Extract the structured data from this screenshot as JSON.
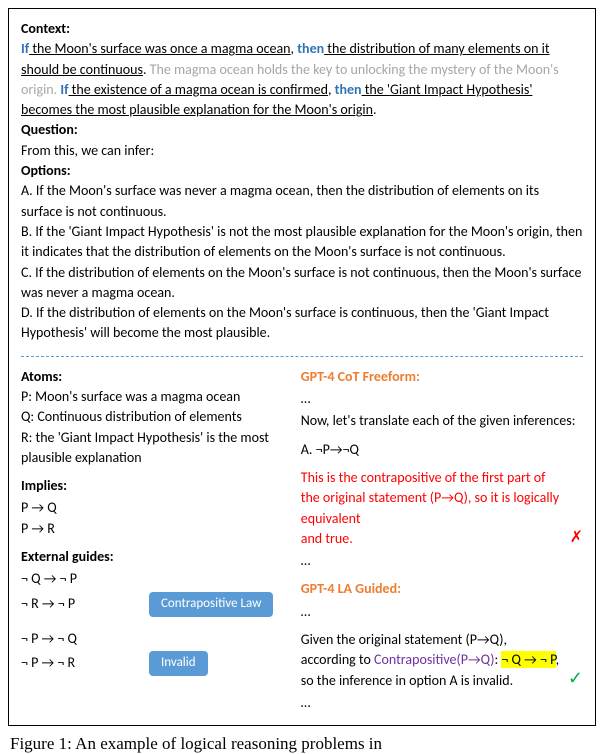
{
  "context": {
    "label": "Context:",
    "s1_if": "If",
    "s1_cond": " the Moon's surface was once a magma ocean",
    "s1_comma": ", ",
    "s1_then": "then",
    "s1_cons": " the distribution of many elements on it should be continuous",
    "s1_period": ". ",
    "s2": "The magma ocean holds the key to unlocking the mystery of the Moon's origin. ",
    "s3_if": "If",
    "s3_cond": " the existence of a magma ocean is confirmed",
    "s3_comma": ", ",
    "s3_then": "then",
    "s3_cons": " the 'Giant Impact Hypothesis' becomes the most plausible explanation for the Moon's origin",
    "s3_period": "."
  },
  "question": {
    "label": "Question:",
    "text": "From this, we can infer:"
  },
  "options": {
    "label": "Options:",
    "A": "A. If the Moon's surface was never a magma ocean, then the distribution of elements on its surface is not continuous.",
    "B": "B. If the 'Giant Impact Hypothesis' is not the most plausible explanation for the Moon's origin, then it indicates that the distribution of elements on the Moon's surface is not continuous.",
    "C": "C. If the distribution of elements on the Moon's surface is not continuous, then the Moon's surface was never a magma ocean.",
    "D": "D. If the distribution of elements on the Moon's surface is continuous, then the 'Giant Impact Hypothesis' will become the most plausible."
  },
  "left": {
    "atoms_label": "Atoms:",
    "P": "P: Moon's surface was a magma ocean",
    "Q": "Q: Continuous distribution of elements",
    "R": "R: the 'Giant Impact Hypothesis' is the most plausible explanation",
    "implies_label": "Implies:",
    "imp1": "P → Q",
    "imp2": "P → R",
    "guides_label": "External guides:",
    "g1a": "¬ Q → ¬ P",
    "g1b": "¬ R → ¬ P",
    "pill1": "Contrapositive Law",
    "g2a": "¬ P → ¬ Q",
    "g2b": "¬ P → ¬ R",
    "pill2": "Invalid"
  },
  "right": {
    "freeform_label": "GPT-4 CoT Freeform:",
    "ell": "…",
    "line1": "Now, let's translate each of the given inferences:",
    "line2": "A. ¬P→¬Q",
    "red1": "This is the contrapositive of the first part of the original statement (P→Q), so it is logically equivalent",
    "red2": " and true.",
    "guided_label": "GPT-4 LA Guided:",
    "g_line_a": "Given the original statement (P→Q),  according to ",
    "g_purple": "Contrapositive(P→Q)",
    "g_colon": ": ",
    "g_hl": "¬ Q → ¬ P",
    "g_tail": ", so the inference in option A is invalid.",
    "x": "✗",
    "check": "✓"
  },
  "caption": "Figure 1: An example of logical reasoning problems in"
}
